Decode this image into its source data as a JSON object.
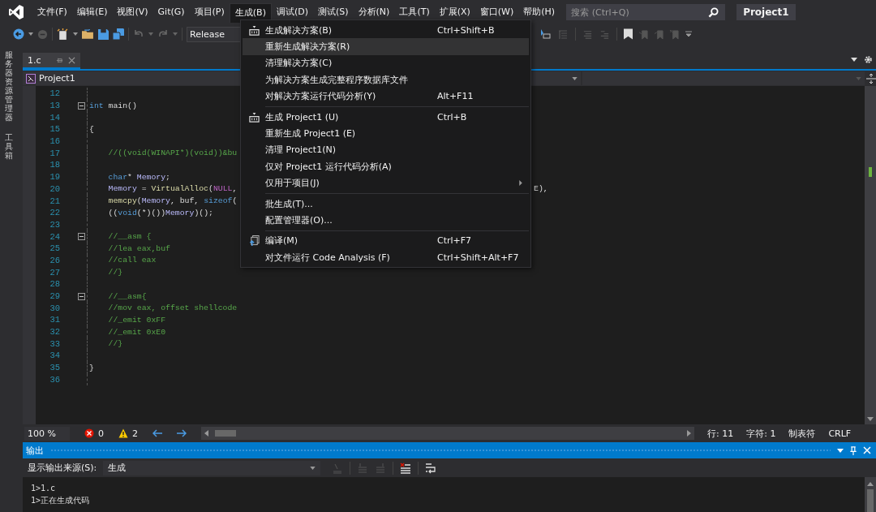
{
  "menubar": [
    {
      "label": "文件(F)",
      "selected": false
    },
    {
      "label": "编辑(E)",
      "selected": false
    },
    {
      "label": "视图(V)",
      "selected": false
    },
    {
      "label": "Git(G)",
      "selected": false
    },
    {
      "label": "项目(P)",
      "selected": false
    },
    {
      "label": "生成(B)",
      "selected": true
    },
    {
      "label": "调试(D)",
      "selected": false
    },
    {
      "label": "测试(S)",
      "selected": false
    },
    {
      "label": "分析(N)",
      "selected": false
    },
    {
      "label": "工具(T)",
      "selected": false
    },
    {
      "label": "扩展(X)",
      "selected": false
    },
    {
      "label": "窗口(W)",
      "selected": false
    },
    {
      "label": "帮助(H)",
      "selected": false
    }
  ],
  "search": {
    "placeholder": "搜索 (Ctrl+Q)"
  },
  "solution_name": "Project1",
  "toolbar": {
    "configuration": "Release"
  },
  "side_tabs": [
    "服务器资源管理器",
    "工具箱"
  ],
  "document_tab": {
    "label": "1.c",
    "selected": true
  },
  "navigation": {
    "project": "Project1"
  },
  "code_lines": [
    {
      "number": "12"
    },
    {
      "number": "13",
      "fold": true,
      "tokens": [
        {
          "kind": "keyword",
          "text": "int"
        },
        {
          "kind": "plain",
          "text": " main()"
        }
      ]
    },
    {
      "number": "14"
    },
    {
      "number": "15",
      "tokens": [
        {
          "kind": "plain",
          "text": "{"
        }
      ]
    },
    {
      "number": "16"
    },
    {
      "number": "17",
      "tokens": [
        {
          "kind": "comment",
          "text": "    //((void(WINAPI*)(void))&bu"
        }
      ]
    },
    {
      "number": "18"
    },
    {
      "number": "19",
      "tokens": [
        {
          "kind": "keyword",
          "text": "    char"
        },
        {
          "kind": "plain",
          "text": "* "
        },
        {
          "kind": "ident",
          "text": "Memory"
        },
        {
          "kind": "plain",
          "text": ";"
        }
      ]
    },
    {
      "number": "20",
      "tokens": [
        {
          "kind": "ident",
          "text": "    Memory"
        },
        {
          "kind": "plain",
          "text": " = "
        },
        {
          "kind": "func",
          "text": "VirtualAlloc"
        },
        {
          "kind": "plain",
          "text": "("
        },
        {
          "kind": "macro",
          "text": "NULL"
        },
        {
          "kind": "plain",
          "text": ","
        }
      ],
      "tail": "E),"
    },
    {
      "number": "21",
      "tokens": [
        {
          "kind": "func",
          "text": "    memcpy"
        },
        {
          "kind": "plain",
          "text": "("
        },
        {
          "kind": "ident",
          "text": "Memory"
        },
        {
          "kind": "plain",
          "text": ", buf, "
        },
        {
          "kind": "keyword",
          "text": "sizeof"
        },
        {
          "kind": "plain",
          "text": "("
        }
      ]
    },
    {
      "number": "22",
      "tokens": [
        {
          "kind": "plain",
          "text": "    (("
        },
        {
          "kind": "keyword",
          "text": "void"
        },
        {
          "kind": "plain",
          "text": "(*)())"
        },
        {
          "kind": "ident",
          "text": "Memory"
        },
        {
          "kind": "plain",
          "text": ")();"
        }
      ]
    },
    {
      "number": "23"
    },
    {
      "number": "24",
      "fold": true,
      "tokens": [
        {
          "kind": "comment",
          "text": "    //__asm {"
        }
      ]
    },
    {
      "number": "25",
      "tokens": [
        {
          "kind": "comment",
          "text": "    //lea eax,buf"
        }
      ]
    },
    {
      "number": "26",
      "tokens": [
        {
          "kind": "comment",
          "text": "    //call eax"
        }
      ]
    },
    {
      "number": "27",
      "tokens": [
        {
          "kind": "comment",
          "text": "    //}"
        }
      ]
    },
    {
      "number": "28"
    },
    {
      "number": "29",
      "fold": true,
      "tokens": [
        {
          "kind": "comment",
          "text": "    //__asm{"
        }
      ]
    },
    {
      "number": "30",
      "tokens": [
        {
          "kind": "comment",
          "text": "    //mov eax, offset shellcode"
        }
      ]
    },
    {
      "number": "31",
      "tokens": [
        {
          "kind": "comment",
          "text": "    //_emit 0xFF"
        }
      ]
    },
    {
      "number": "32",
      "tokens": [
        {
          "kind": "comment",
          "text": "    //_emit 0xE0"
        }
      ]
    },
    {
      "number": "33",
      "tokens": [
        {
          "kind": "comment",
          "text": "    //}"
        }
      ]
    },
    {
      "number": "34"
    },
    {
      "number": "35",
      "tokens": [
        {
          "kind": "plain",
          "text": "}"
        }
      ]
    },
    {
      "number": "36"
    }
  ],
  "build_menu": [
    {
      "kind": "build",
      "label": "生成解决方案(B)",
      "shortcut": "Ctrl+Shift+B",
      "selected": false
    },
    {
      "kind": "item",
      "label": "重新生成解决方案(R)",
      "selected": true
    },
    {
      "kind": "item",
      "label": "清理解决方案(C)",
      "selected": false
    },
    {
      "kind": "item",
      "label": "为解决方案生成完整程序数据库文件",
      "selected": false
    },
    {
      "kind": "item",
      "label": "对解决方案运行代码分析(Y)",
      "shortcut": "Alt+F11",
      "selected": false
    },
    {
      "kind": "separator"
    },
    {
      "kind": "build",
      "label": "生成 Project1 (U)",
      "shortcut": "Ctrl+B",
      "selected": false
    },
    {
      "kind": "item",
      "label": "重新生成 Project1 (E)",
      "selected": false
    },
    {
      "kind": "item",
      "label": "清理 Project1(N)",
      "selected": false
    },
    {
      "kind": "item",
      "label": "仅对 Project1 运行代码分析(A)",
      "selected": false
    },
    {
      "kind": "item",
      "label": "仅用于项目(J)",
      "submenu": true,
      "selected": false
    },
    {
      "kind": "separator"
    },
    {
      "kind": "item",
      "label": "批生成(T)...",
      "selected": false
    },
    {
      "kind": "item",
      "label": "配置管理器(O)...",
      "selected": false
    },
    {
      "kind": "separator"
    },
    {
      "kind": "compile",
      "label": "编译(M)",
      "shortcut": "Ctrl+F7",
      "selected": false
    },
    {
      "kind": "item",
      "label": "对文件运行 Code Analysis (F)",
      "shortcut": "Ctrl+Shift+Alt+F7",
      "selected": false
    }
  ],
  "status": {
    "zoom": "100 %",
    "errors": "0",
    "warnings": "2",
    "line": "行: 11",
    "char": "字符: 1",
    "indent": "制表符",
    "line_ending": "CRLF"
  },
  "output": {
    "title": "输出",
    "source_label": "显示输出来源(S):",
    "source": "生成",
    "lines": [
      "1>1.c",
      "1>正在生成代码"
    ]
  }
}
